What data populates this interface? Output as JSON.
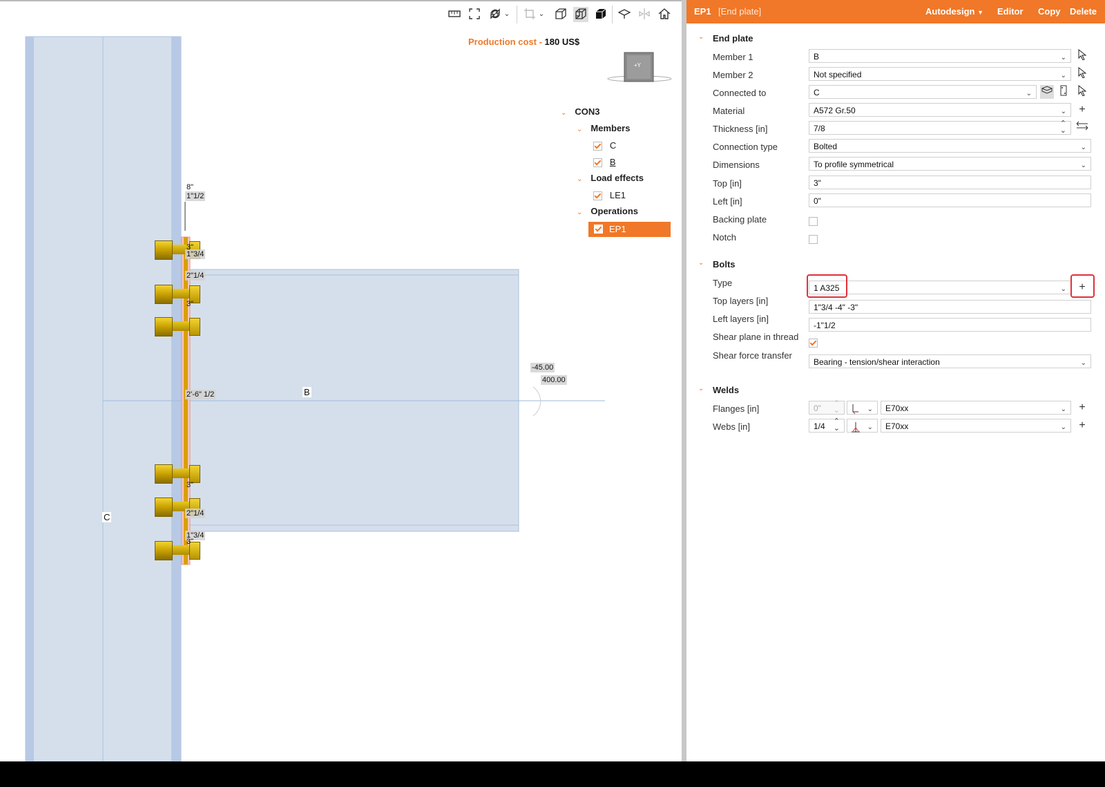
{
  "toolbar": {
    "icons": [
      "ruler-icon",
      "zoom-extents-icon",
      "rotate-icon",
      "chevron-down-icon",
      "crop-icon",
      "chevron-down-icon",
      "wireframe-icon",
      "transparent-view-icon",
      "solid-view-icon",
      "cut-view-icon",
      "mirror-icon",
      "home-icon"
    ]
  },
  "production_cost": {
    "label": "Production cost",
    "separator": " - ",
    "value": "180 US$"
  },
  "view_cube": {
    "label": "+Y"
  },
  "tree": {
    "root": "CON3",
    "members_label": "Members",
    "members": [
      {
        "label": "C",
        "checked": true
      },
      {
        "label": "B",
        "checked": true
      }
    ],
    "load_effects_label": "Load effects",
    "load_effects": [
      {
        "label": "LE1",
        "checked": true
      }
    ],
    "operations_label": "Operations",
    "operations": [
      {
        "label": "EP1",
        "checked": true
      }
    ]
  },
  "dimensions": {
    "d1": "8\"",
    "d2": "1\"1/2",
    "d3": "3\"",
    "d4": "1\"3/4",
    "d5": "2\"1/4",
    "d6": "3\"",
    "d7": "2'-6\" 1/2",
    "d8": "3\"",
    "d9": "2\"1/4",
    "d10": "1\"3/4",
    "d11": "3\""
  },
  "member_labels": {
    "beam": "B",
    "column": "C"
  },
  "angles": {
    "a1": "-45.00",
    "a2": "400.00"
  },
  "panel": {
    "header": {
      "title": "EP1",
      "subtitle": "[End plate]",
      "autodesign": "Autodesign",
      "editor": "Editor",
      "copy": "Copy",
      "delete": "Delete"
    },
    "end_plate": {
      "section": "End plate",
      "member1_label": "Member 1",
      "member1_value": "B",
      "member2_label": "Member 2",
      "member2_value": "Not specified",
      "connected_label": "Connected to",
      "connected_value": "C",
      "material_label": "Material",
      "material_value": "A572 Gr.50",
      "thickness_label": "Thickness [in]",
      "thickness_value": "7/8",
      "conntype_label": "Connection type",
      "conntype_value": "Bolted",
      "dimensions_label": "Dimensions",
      "dimensions_value": "To profile symmetrical",
      "top_label": "Top [in]",
      "top_value": "3\"",
      "left_label": "Left [in]",
      "left_value": "0\"",
      "backing_label": "Backing plate",
      "backing_checked": false,
      "notch_label": "Notch",
      "notch_checked": false
    },
    "bolts": {
      "section": "Bolts",
      "type_label": "Type",
      "type_value": "1 A325",
      "top_layers_label": "Top layers [in]",
      "top_layers_value": "1\"3/4 -4\" -3\"",
      "left_layers_label": "Left layers [in]",
      "left_layers_value": "-1\"1/2",
      "shear_plane_label": "Shear plane in thread",
      "shear_plane_checked": true,
      "shear_transfer_label": "Shear force transfer",
      "shear_transfer_value": "Bearing - tension/shear interaction"
    },
    "welds": {
      "section": "Welds",
      "flanges_label": "Flanges [in]",
      "flanges_value": "0\"",
      "flanges_material": "E70xx",
      "webs_label": "Webs [in]",
      "webs_value": "1/4",
      "webs_material": "E70xx"
    }
  },
  "colors": {
    "accent": "#f07828",
    "member_fill": "#d5dfec",
    "member_edge": "#a9c0de",
    "highlight": "#e0303c"
  }
}
